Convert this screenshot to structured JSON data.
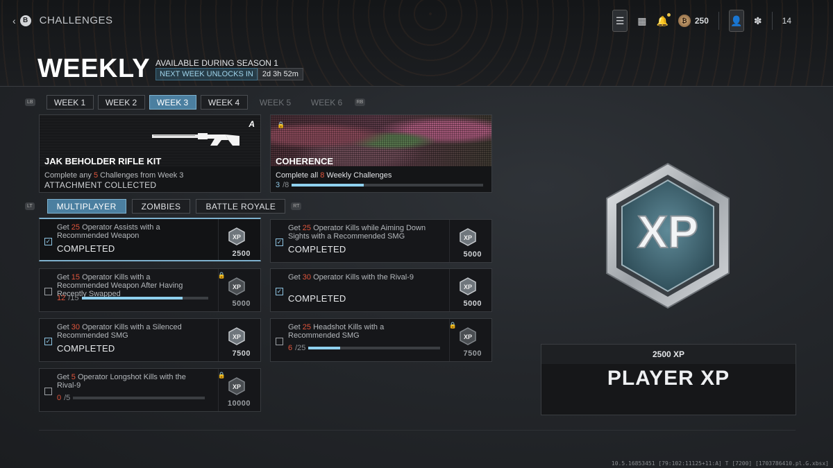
{
  "header": {
    "back_button": "B",
    "title": "CHALLENGES",
    "cod_points": "250",
    "level": "14"
  },
  "hero": {
    "title": "WEEKLY",
    "available": "AVAILABLE DURING SEASON 1",
    "unlock_label": "NEXT WEEK UNLOCKS IN",
    "unlock_timer": "2d 3h 52m"
  },
  "weeks": {
    "left_bumper": "LB",
    "right_bumper": "RB",
    "items": [
      {
        "label": "WEEK 1",
        "state": "normal"
      },
      {
        "label": "WEEK 2",
        "state": "normal"
      },
      {
        "label": "WEEK 3",
        "state": "active"
      },
      {
        "label": "WEEK 4",
        "state": "normal"
      },
      {
        "label": "WEEK 5",
        "state": "locked"
      },
      {
        "label": "WEEK 6",
        "state": "locked"
      }
    ]
  },
  "rewards": {
    "weapon": {
      "name": "JAK BEHOLDER RIFLE KIT",
      "desc_pre": "Complete any ",
      "desc_num": "5",
      "desc_post": " Challenges from Week 3",
      "status": "ATTACHMENT COLLECTED",
      "logo": "A"
    },
    "camo": {
      "name": "COHERENCE",
      "desc_pre": "Complete all ",
      "desc_num": "8",
      "desc_post": " Weekly Challenges",
      "progress_current": "3",
      "progress_total": "/8",
      "progress_fraction": 0.375
    }
  },
  "modes": {
    "left_trigger": "LT",
    "right_trigger": "RT",
    "items": [
      {
        "label": "MULTIPLAYER",
        "active": true
      },
      {
        "label": "ZOMBIES",
        "active": false
      },
      {
        "label": "BATTLE ROYALE",
        "active": false
      }
    ]
  },
  "challenges": [
    {
      "pre": "Get ",
      "num": "25",
      "post": " Operator Assists with a Recommended Weapon",
      "status": "COMPLETED",
      "xp": "2500",
      "done": true
    },
    {
      "pre": "Get ",
      "num": "25",
      "post": " Operator Kills while Aiming Down Sights with a Recommended SMG",
      "status": "COMPLETED",
      "xp": "5000",
      "done": true
    },
    {
      "pre": "Get ",
      "num": "15",
      "post": " Operator Kills with a Recommended Weapon After Having Recently Swapped",
      "current": "12",
      "total": "/15",
      "fraction": 0.8,
      "xp": "5000",
      "done": false
    },
    {
      "pre": "Get ",
      "num": "30",
      "post": " Operator Kills with the Rival-9",
      "status": "COMPLETED",
      "xp": "5000",
      "done": true
    },
    {
      "pre": "Get ",
      "num": "30",
      "post": " Operator Kills with a Silenced Recommended SMG",
      "status": "COMPLETED",
      "xp": "7500",
      "done": true
    },
    {
      "pre": "Get ",
      "num": "25",
      "post": " Headshot Kills with a Recommended SMG",
      "current": "6",
      "total": "/25",
      "fraction": 0.24,
      "xp": "7500",
      "done": false
    },
    {
      "pre": "Get ",
      "num": "5",
      "post": " Operator Longshot Kills with the Rival-9",
      "current": "0",
      "total": "/5",
      "fraction": 0.0,
      "xp": "10000",
      "done": false
    }
  ],
  "detail": {
    "badge_text": "XP",
    "amount": "2500 XP",
    "title": "PLAYER XP"
  },
  "footer": {
    "debug": "10.5.16853451 [79:102:11125+11:A] T [7200] [1703786410.pl.G.xbsx]"
  }
}
